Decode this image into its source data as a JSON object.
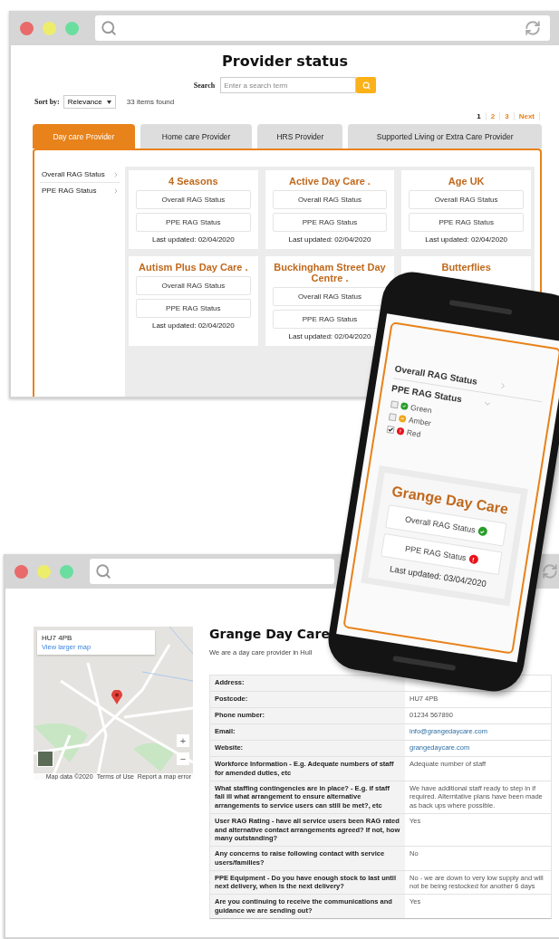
{
  "top_window": {
    "title": "Provider status",
    "search": {
      "label": "Search",
      "placeholder": "Enter a search term"
    },
    "sort": {
      "label": "Sort by:",
      "value": "Relevance"
    },
    "results_count": "33 items found",
    "pagination": [
      {
        "label": "1",
        "selected": true
      },
      {
        "label": "2",
        "selected": false
      },
      {
        "label": "3",
        "selected": false
      },
      {
        "label": "Next",
        "selected": false
      }
    ],
    "tabs": [
      {
        "label": "Day care Provider",
        "selected": true
      },
      {
        "label": "Home care Provider",
        "selected": false
      },
      {
        "label": "HRS Provider",
        "selected": false
      },
      {
        "label": "Supported Living or Extra Care Provider",
        "selected": false
      }
    ],
    "filters": [
      "Overall RAG Status",
      "PPE RAG Status"
    ],
    "providers": [
      {
        "name": "4 Seasons",
        "statuses": [
          "Overall RAG Status",
          "PPE RAG Status"
        ],
        "updated": "Last updated: 02/04/2020"
      },
      {
        "name": "Active Day Care .",
        "statuses": [
          "Overall RAG Status",
          "PPE RAG Status"
        ],
        "updated": "Last updated: 02/04/2020"
      },
      {
        "name": "Age UK",
        "statuses": [
          "Overall RAG Status",
          "PPE RAG Status"
        ],
        "updated": "Last updated: 02/04/2020"
      },
      {
        "name": "Autism Plus Day Care .",
        "statuses": [
          "Overall RAG Status",
          "PPE RAG Status"
        ],
        "updated": "Last updated: 02/04/2020"
      },
      {
        "name": "Buckingham Street Day Centre .",
        "statuses": [
          "Overall RAG Status",
          "PPE RAG Status"
        ],
        "updated": "Last updated: 02/04/2020"
      },
      {
        "name": "Butterflies"
      }
    ]
  },
  "phone": {
    "filters": [
      {
        "label": "Overall RAG Status",
        "expanded": false
      },
      {
        "label": "PPE RAG Status",
        "expanded": true,
        "options": [
          {
            "label": "Green",
            "checked": false,
            "kind": "ok",
            "color": "#2a9d2a"
          },
          {
            "label": "Amber",
            "checked": false,
            "kind": "warning",
            "color": "#f0a81c"
          },
          {
            "label": "Red",
            "checked": true,
            "kind": "alert",
            "color": "#e8131b"
          }
        ]
      }
    ],
    "card": {
      "name": "Grange Day Care",
      "statuses": [
        {
          "label": "Overall RAG Status",
          "kind": "ok",
          "color": "#2a9d2a"
        },
        {
          "label": "PPE RAG Status",
          "kind": "alert",
          "color": "#e8131b"
        }
      ],
      "updated": "Last updated: 03/04/2020"
    }
  },
  "bottom_window": {
    "map": {
      "postcode": "HU7 4PB",
      "link": "View larger map",
      "zoom_controls": [
        "+",
        "−"
      ],
      "footer": [
        "Map data ©2020",
        "Terms of Use",
        "Report a map error"
      ]
    },
    "title": "Grange Day Care",
    "subtitle": "We are a day care provider in Hull",
    "details": [
      {
        "label": "Address:"
      },
      {
        "label": "Postcode:",
        "value": "HU7 4PB",
        "kind": "text"
      },
      {
        "label": "Phone number:",
        "value": "01234 567890",
        "kind": "text"
      },
      {
        "label": "Email:",
        "value": "info@grangedaycare.com",
        "kind": "link"
      },
      {
        "label": "Website:",
        "value": "grangedaycare.com",
        "kind": "link"
      },
      {
        "label": "Workforce Information - E.g. Adequate numbers of staff for amended duties, etc",
        "value": "Adequate number of staff",
        "kind": "text"
      },
      {
        "label": "What staffing contingencies are in place? - E.g. if staff fall ill what arrangement to ensure alternative arrangements to service users can still be met?, etc",
        "value": "We have additional staff ready to step in if required. Alterntative plans have been made as back ups where possible.",
        "kind": "text"
      },
      {
        "label": "User RAG Rating - have all service users been RAG rated and alternative contact arrangements agreed? If not, how many outstanding?",
        "value": "Yes",
        "kind": "text"
      },
      {
        "label": "Any concerns to raise following contact with service users/families?",
        "value": "No",
        "kind": "text"
      },
      {
        "label": "PPE Equipment - Do you have enough stock to last until next delivery, when is the next delivery?",
        "value": "No - we are down to very low supply and will not be being restocked for another 6 days",
        "kind": "text"
      },
      {
        "label": "Are you continuing to receive the communications and guidance we are sending out?",
        "value": "Yes",
        "kind": "text"
      }
    ]
  }
}
